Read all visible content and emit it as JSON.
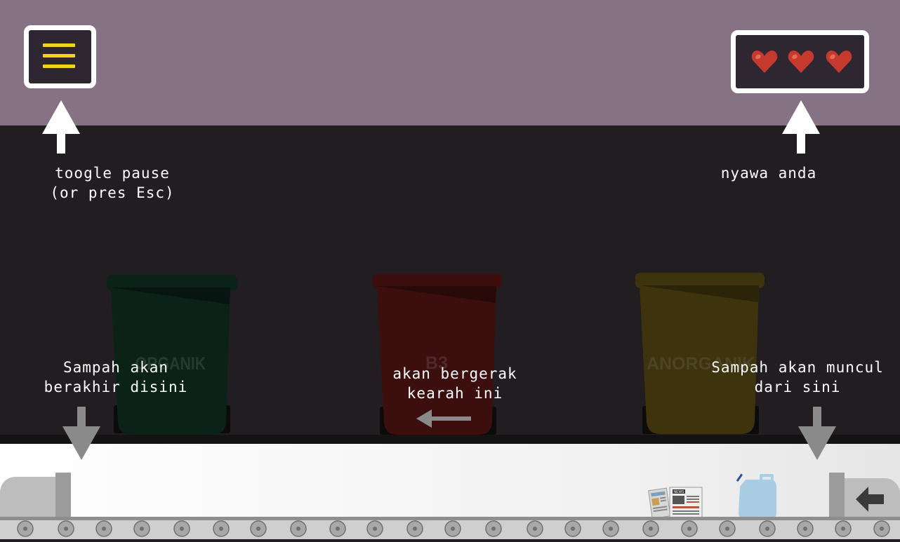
{
  "colors": {
    "top_band": "#857385",
    "play_area": "#211d20",
    "menu_bars": "#f5d21a",
    "heart": "#c63a2e",
    "bin_organik": "#0b2219",
    "bin_b3": "#3d0e0e",
    "bin_anorganik": "#3d330d"
  },
  "hud": {
    "pause_button_icon": "hamburger-menu-icon",
    "lives_remaining": 3,
    "lives_max": 3
  },
  "hints": {
    "pause_line1": "toogle pause",
    "pause_line2": "(or pres Esc)",
    "lives": "nyawa anda",
    "end_line1": "Sampah akan",
    "end_line2": "berakhir disini",
    "direction_line1": "akan bergerak",
    "direction_line2": "kearah ini",
    "spawn_line1": "Sampah akan muncul",
    "spawn_line2": "dari sini"
  },
  "bins": [
    {
      "label": "ORGANIK"
    },
    {
      "label": "B3"
    },
    {
      "label": "ANORGANIK"
    }
  ],
  "items_on_belt": [
    "newspaper",
    "jerrycan"
  ],
  "newspaper_masthead": "NEWS"
}
